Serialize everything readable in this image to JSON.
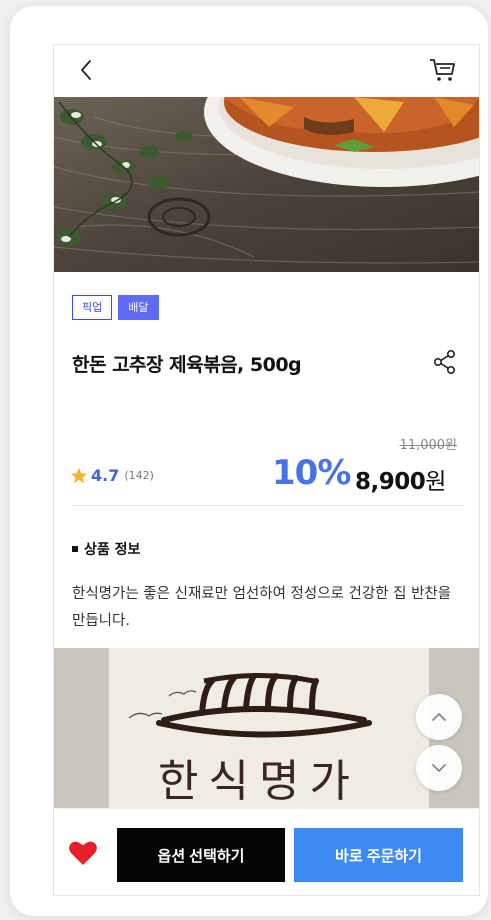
{
  "header": {
    "back_icon": "chevron-left-icon",
    "cart_icon": "cart-icon"
  },
  "product": {
    "badges": [
      "픽업",
      "배달"
    ],
    "title": "한돈 고추장 제육볶음, 500g",
    "original_price": "11,000원",
    "rating": "4.7",
    "review_count": "(142)",
    "discount": "10%",
    "price": "8,900",
    "price_unit": "원"
  },
  "info": {
    "section_title": "상품 정보",
    "description": "한식명가는 좋은 신재료만 엄선하여 정성으로 건강한 집 반찬을 만듭니다."
  },
  "brand_image": {
    "text": "한식명가"
  },
  "bottom": {
    "option_label": "옵션 선택하기",
    "order_label": "바로 주문하기"
  },
  "colors": {
    "accent_blue": "#4a72e6",
    "order_button": "#3d8af2",
    "badge_fill": "#5e6bf2",
    "heart": "#e8202c",
    "star": "#f2b52c"
  }
}
